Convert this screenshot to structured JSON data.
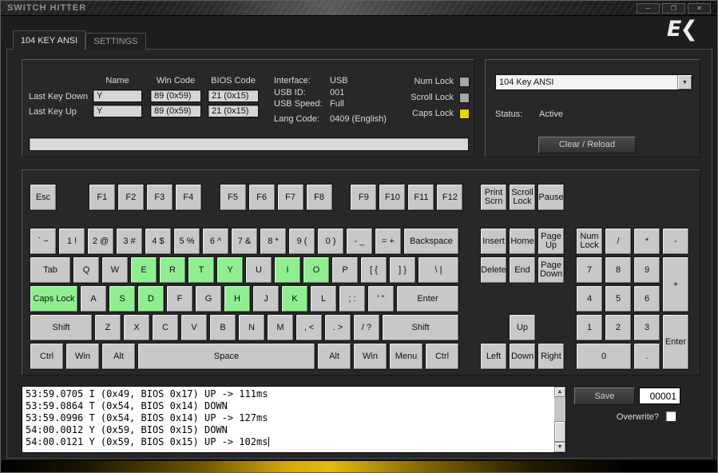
{
  "window": {
    "title": "SWITCH HITTER"
  },
  "icons": {
    "minimize": "─",
    "maximize": "❐",
    "close": "✕",
    "dropdown_arrow": "▼",
    "scroll_up": "▲",
    "scroll_down": "▼"
  },
  "logo": {
    "text": "E❮"
  },
  "tabs": [
    {
      "label": "104 KEY ANSI",
      "active": true
    },
    {
      "label": "SETTINGS",
      "active": false
    }
  ],
  "info_panel": {
    "headers": {
      "name": "Name",
      "win_code": "Win Code",
      "bios_code": "BIOS Code"
    },
    "rows": [
      {
        "label": "Last Key Down",
        "name": "Y",
        "win": "89 (0x59)",
        "bios": "21 (0x15)"
      },
      {
        "label": "Last Key Up",
        "name": "Y",
        "win": "89 (0x59)",
        "bios": "21 (0x15)"
      }
    ],
    "details": [
      {
        "label": "Interface:",
        "value": "USB"
      },
      {
        "label": "USB ID:",
        "value": "001"
      },
      {
        "label": "USB Speed:",
        "value": "Full"
      },
      {
        "label": "Lang Code:",
        "value": "0409 (English)"
      }
    ],
    "locks": [
      {
        "label": "Num Lock",
        "on": false
      },
      {
        "label": "Scroll Lock",
        "on": false
      },
      {
        "label": "Caps Lock",
        "on": true
      }
    ],
    "typing_area_value": ""
  },
  "layout_panel": {
    "selected_layout": "104 Key ANSI",
    "status_label": "Status:",
    "status_value": "Active",
    "clear_reload_label": "Clear / Reload"
  },
  "keyboard": {
    "function_row": [
      {
        "label": "Esc",
        "w": 1
      },
      {
        "label": "F1",
        "w": 1,
        "g": 1.05
      },
      {
        "label": "F2",
        "w": 1
      },
      {
        "label": "F3",
        "w": 1
      },
      {
        "label": "F4",
        "w": 1
      },
      {
        "label": "F5",
        "w": 1,
        "g": 0.55
      },
      {
        "label": "F6",
        "w": 1
      },
      {
        "label": "F7",
        "w": 1
      },
      {
        "label": "F8",
        "w": 1
      },
      {
        "label": "F9",
        "w": 1,
        "g": 0.55
      },
      {
        "label": "F10",
        "w": 1
      },
      {
        "label": "F11",
        "w": 1
      },
      {
        "label": "F12",
        "w": 1
      }
    ],
    "main_rows": [
      [
        {
          "label": "` ~",
          "n": "backtick",
          "w": 1
        },
        {
          "label": "1 !",
          "n": "1",
          "w": 1
        },
        {
          "label": "2 @",
          "n": "2",
          "w": 1
        },
        {
          "label": "3 #",
          "n": "3",
          "w": 1
        },
        {
          "label": "4 $",
          "n": "4",
          "w": 1
        },
        {
          "label": "5 %",
          "n": "5",
          "w": 1
        },
        {
          "label": "6 ^",
          "n": "6",
          "w": 1
        },
        {
          "label": "7 &",
          "n": "7",
          "w": 1
        },
        {
          "label": "8 *",
          "n": "8",
          "w": 1
        },
        {
          "label": "9 (",
          "n": "9",
          "w": 1
        },
        {
          "label": "0 )",
          "n": "0",
          "w": 1
        },
        {
          "label": "- _",
          "n": "minus",
          "w": 1
        },
        {
          "label": "= +",
          "n": "equals",
          "w": 1
        },
        {
          "label": "Backspace",
          "w": 2
        }
      ],
      [
        {
          "label": "Tab",
          "w": 1.5
        },
        {
          "label": "Q",
          "w": 1
        },
        {
          "label": "W",
          "w": 1
        },
        {
          "label": "E",
          "w": 1,
          "tested": true
        },
        {
          "label": "R",
          "w": 1,
          "tested": true
        },
        {
          "label": "T",
          "w": 1,
          "tested": true
        },
        {
          "label": "Y",
          "w": 1,
          "tested": true
        },
        {
          "label": "U",
          "w": 1
        },
        {
          "label": "I",
          "w": 1,
          "tested": true
        },
        {
          "label": "O",
          "w": 1,
          "tested": true
        },
        {
          "label": "P",
          "w": 1
        },
        {
          "label": "[ {",
          "n": "bracket-open",
          "w": 1
        },
        {
          "label": "] }",
          "n": "bracket-close",
          "w": 1
        },
        {
          "label": "\\ |",
          "n": "backslash",
          "w": 1.5
        }
      ],
      [
        {
          "label": "Caps Lock",
          "w": 1.75,
          "tested": true
        },
        {
          "label": "A",
          "w": 1
        },
        {
          "label": "S",
          "w": 1,
          "tested": true
        },
        {
          "label": "D",
          "w": 1,
          "tested": true
        },
        {
          "label": "F",
          "w": 1
        },
        {
          "label": "G",
          "w": 1
        },
        {
          "label": "H",
          "w": 1,
          "tested": true
        },
        {
          "label": "J",
          "w": 1
        },
        {
          "label": "K",
          "w": 1,
          "tested": true
        },
        {
          "label": "L",
          "w": 1
        },
        {
          "label": "; :",
          "n": "semicolon",
          "w": 1
        },
        {
          "label": "' \"",
          "n": "quote",
          "w": 1
        },
        {
          "label": "Enter",
          "w": 2.25
        }
      ],
      [
        {
          "label": "Shift",
          "n": "shift-left",
          "w": 2.25
        },
        {
          "label": "Z",
          "w": 1
        },
        {
          "label": "X",
          "w": 1
        },
        {
          "label": "C",
          "w": 1
        },
        {
          "label": "V",
          "w": 1
        },
        {
          "label": "B",
          "w": 1
        },
        {
          "label": "N",
          "w": 1
        },
        {
          "label": "M",
          "w": 1
        },
        {
          "label": ", <",
          "n": "comma",
          "w": 1
        },
        {
          "label": ". >",
          "n": "period",
          "w": 1
        },
        {
          "label": "/ ?",
          "n": "slash",
          "w": 1
        },
        {
          "label": "Shift",
          "n": "shift-right",
          "w": 2.75
        }
      ],
      [
        {
          "label": "Ctrl",
          "n": "ctrl-left",
          "w": 1.25
        },
        {
          "label": "Win",
          "n": "win-left",
          "w": 1.25
        },
        {
          "label": "Alt",
          "n": "alt-left",
          "w": 1.25
        },
        {
          "label": "Space",
          "w": 6.25
        },
        {
          "label": "Alt",
          "n": "alt-right",
          "w": 1.25
        },
        {
          "label": "Win",
          "n": "win-right",
          "w": 1.25
        },
        {
          "label": "Menu",
          "w": 1.25
        },
        {
          "label": "Ctrl",
          "n": "ctrl-right",
          "w": 1.25
        }
      ]
    ],
    "nav_function_row": [
      {
        "label": "Print Scrn",
        "n": "print-screen",
        "w": 1
      },
      {
        "label": "Scroll Lock",
        "w": 1
      },
      {
        "label": "Pause",
        "w": 1
      }
    ],
    "nav_rows": [
      [
        {
          "label": "Insert",
          "w": 1
        },
        {
          "label": "Home",
          "w": 1
        },
        {
          "label": "Page Up",
          "w": 1
        }
      ],
      [
        {
          "label": "Delete",
          "w": 1
        },
        {
          "label": "End",
          "w": 1
        },
        {
          "label": "Page Down",
          "w": 1
        }
      ],
      [
        null,
        null,
        null
      ],
      [
        null,
        {
          "label": "Up",
          "n": "arrow-up",
          "w": 1
        },
        null
      ],
      [
        {
          "label": "Left",
          "n": "arrow-left",
          "w": 1
        },
        {
          "label": "Down",
          "n": "arrow-down",
          "w": 1
        },
        {
          "label": "Right",
          "n": "arrow-right",
          "w": 1
        }
      ]
    ],
    "numpad": [
      {
        "label": "Num Lock",
        "n": "numpad-numlock"
      },
      {
        "label": "/",
        "n": "numpad-divide"
      },
      {
        "label": "*",
        "n": "numpad-multiply"
      },
      {
        "label": "-",
        "n": "numpad-minus"
      },
      {
        "label": "7",
        "n": "numpad-7"
      },
      {
        "label": "8",
        "n": "numpad-8"
      },
      {
        "label": "9",
        "n": "numpad-9"
      },
      {
        "label": "+",
        "n": "numpad-plus",
        "rows": 2
      },
      {
        "label": "4",
        "n": "numpad-4"
      },
      {
        "label": "5",
        "n": "numpad-5"
      },
      {
        "label": "6",
        "n": "numpad-6"
      },
      {
        "label": "1",
        "n": "numpad-1"
      },
      {
        "label": "2",
        "n": "numpad-2"
      },
      {
        "label": "3",
        "n": "numpad-3"
      },
      {
        "label": "Enter",
        "n": "numpad-enter",
        "rows": 2
      },
      {
        "label": "0",
        "n": "numpad-0",
        "cols": 2
      },
      {
        "label": ".",
        "n": "numpad-decimal"
      }
    ]
  },
  "log_panel": {
    "lines": [
      "53:59.0705 I (0x49, BIOS 0x17) UP -> 111ms",
      "53:59.0864 T (0x54, BIOS 0x14) DOWN",
      "53:59.0996 T (0x54, BIOS 0x14) UP -> 127ms",
      "54:00.0012 Y (0x59, BIOS 0x15) DOWN",
      "54:00.0121 Y (0x59, BIOS 0x15) UP -> 102ms"
    ],
    "save_label": "Save",
    "counter_value": "00001",
    "overwrite_label": "Overwrite?"
  },
  "colors": {
    "key_default": "#c8c8c8",
    "key_tested": "#90ee90",
    "lock_on": "#e8d400",
    "lock_off": "#a6a6a6",
    "accent_gold": "#d2a806"
  }
}
